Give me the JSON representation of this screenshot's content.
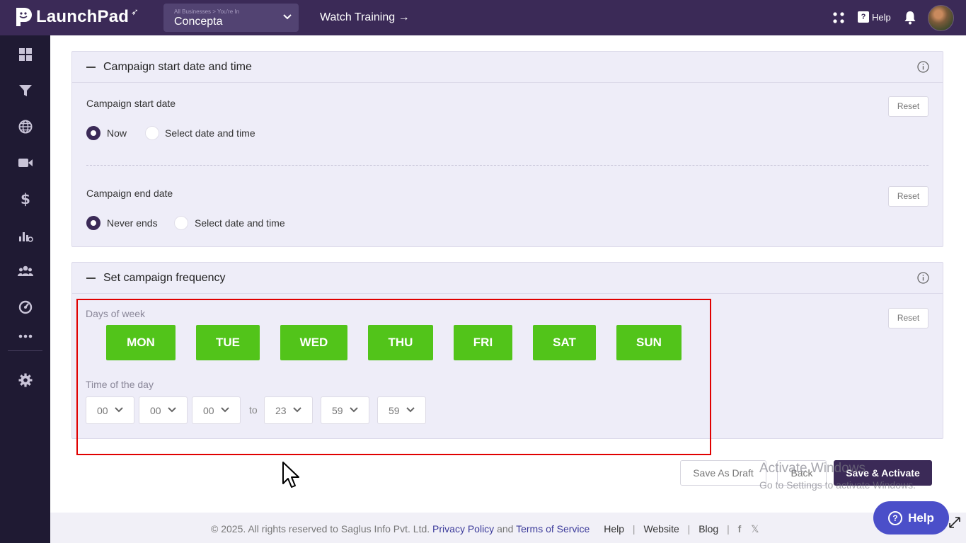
{
  "app": {
    "name": "LaunchPad"
  },
  "header": {
    "business_sublabel": "All Businesses > You're In",
    "business_name": "Concepta",
    "watch_training": "Watch Training →",
    "help_label": "Help"
  },
  "sidebar": {
    "items": [
      "dashboard-icon",
      "funnel-icon",
      "globe-icon",
      "video-icon",
      "dollar-icon",
      "analytics-icon",
      "users-icon",
      "gauge-icon",
      "more-icon",
      "settings-icon"
    ]
  },
  "start_panel": {
    "title": "Campaign start date and time",
    "start_label": "Campaign start date",
    "start_options": [
      "Now",
      "Select date and time"
    ],
    "start_selected": "Now",
    "end_label": "Campaign end date",
    "end_options": [
      "Never ends",
      "Select date and time"
    ],
    "end_selected": "Never ends",
    "reset_label": "Reset"
  },
  "frequency_panel": {
    "title": "Set campaign frequency",
    "days_label": "Days of week",
    "days": [
      "MON",
      "TUE",
      "WED",
      "THU",
      "FRI",
      "SAT",
      "SUN"
    ],
    "time_label": "Time of the day",
    "from_time": [
      "00",
      "00",
      "00"
    ],
    "to_label": "to",
    "to_time": [
      "23",
      "59",
      "59"
    ],
    "reset_label": "Reset"
  },
  "actions": {
    "save_draft": "Save As Draft",
    "back": "Back",
    "save_activate": "Save & Activate"
  },
  "watermark": {
    "line1": "Activate Windows",
    "line2": "Go to Settings to activate Windows."
  },
  "footer": {
    "copyright": "©  2025. All rights reserved to Saglus Info Pvt. Ltd.",
    "privacy": "Privacy Policy",
    "and": "and",
    "terms": "Terms of Service",
    "help": "Help",
    "website": "Website",
    "blog": "Blog"
  },
  "help_fab": {
    "label": "Help"
  },
  "colors": {
    "brand": "#3b2a57",
    "day_active": "#52c41a",
    "highlight": "#e00000"
  }
}
